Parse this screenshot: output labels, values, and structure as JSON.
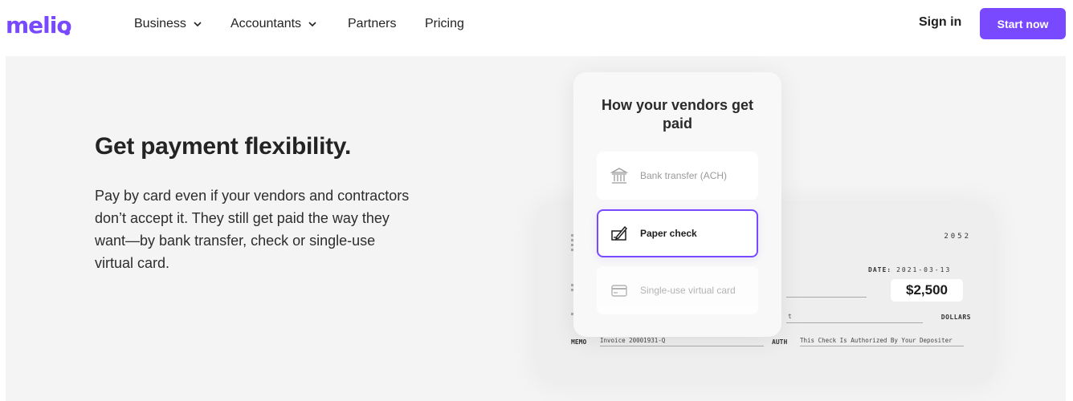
{
  "nav": {
    "logo": "melio",
    "items": [
      {
        "label": "Business",
        "has_dropdown": true
      },
      {
        "label": "Accountants",
        "has_dropdown": true
      },
      {
        "label": "Partners",
        "has_dropdown": false
      },
      {
        "label": "Pricing",
        "has_dropdown": false
      }
    ],
    "sign_in": "Sign in",
    "start_now": "Start now"
  },
  "hero": {
    "headline": "Get payment flexibility.",
    "body": "Pay by card even if your vendors and contractors don’t accept it. They still get paid the way they want—by bank transfer, check or single-use virtual card."
  },
  "card": {
    "title": "How your vendors get paid",
    "options": [
      {
        "label": "Bank transfer (ACH)",
        "icon": "bank-icon",
        "selected": false
      },
      {
        "label": "Paper check",
        "icon": "check-edit-icon",
        "selected": true
      },
      {
        "label": "Single-use virtual card",
        "icon": "credit-card-icon",
        "selected": false
      }
    ]
  },
  "check": {
    "number": "2052",
    "date_label": "DATE:",
    "date_value": "2021-03-13",
    "amount": "$2,500",
    "dollars_label": "DOLLARS",
    "t_fragment": "t",
    "memo_label": "MEMO",
    "memo_value": "Invoice 20001931-Q",
    "auth_label": "AUTH",
    "auth_value": "This Check Is Authorized By Your Depositer"
  },
  "colors": {
    "brand": "#7849ff",
    "hero_bg": "#f4f4f4"
  }
}
